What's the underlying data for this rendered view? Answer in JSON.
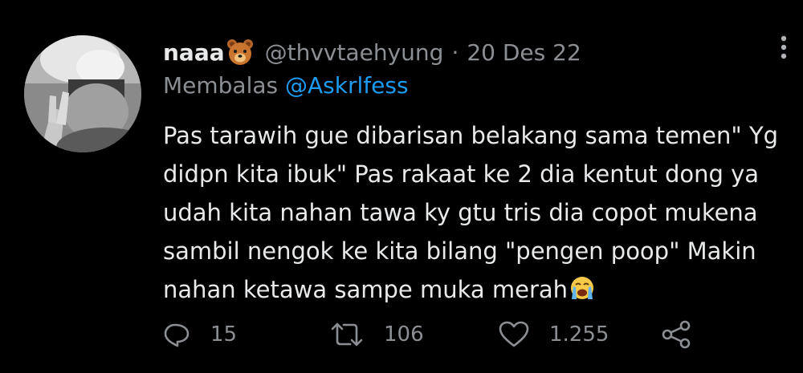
{
  "tweet": {
    "display_name": "naaa",
    "name_emoji": "bear-face-emoji",
    "handle": "@thvvtaehyung",
    "separator": "·",
    "date": "20 Des 22",
    "reply_prefix": "Membalas",
    "reply_to": "@Askrlfess",
    "body_lines": [
      "Pas tarawih gue dibarisan belakang sama temen\" Yg",
      "didpn kita ibuk\" Pas rakaat ke 2 dia kentut dong ya",
      "udah kita nahan tawa ky gtu tris dia copot mukena",
      "sambil nengok ke kita bilang \"pengen poop\" Makin",
      "nahan ketawa sampe muka merah"
    ],
    "body_end_emoji": "loudly-crying-face-emoji"
  },
  "actions": {
    "reply_count": "15",
    "retweet_count": "106",
    "like_count": "1.255"
  },
  "colors": {
    "background": "#000000",
    "text": "#e7e9ea",
    "secondary": "#8b8f94",
    "link": "#1d9bf0"
  },
  "icons": [
    "avatar-image",
    "more-options-icon",
    "reply-icon",
    "retweet-icon",
    "like-icon",
    "share-icon"
  ]
}
